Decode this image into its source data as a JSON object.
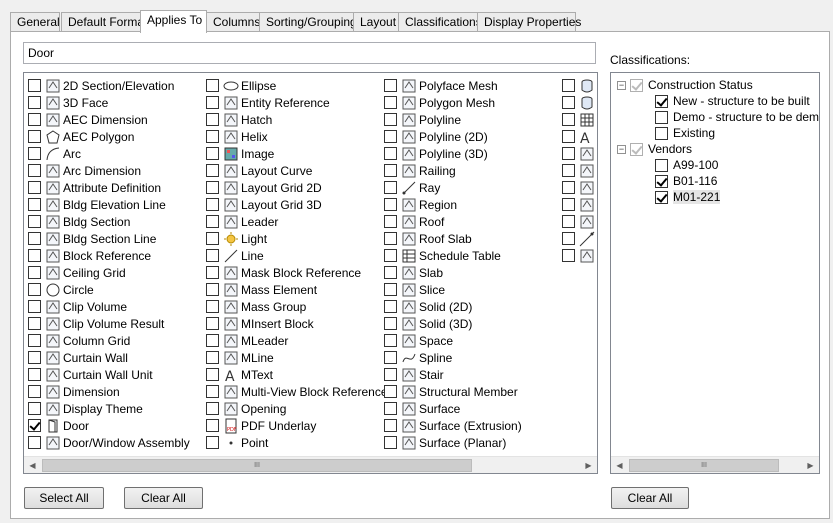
{
  "tabs": [
    "General",
    "Default Format",
    "Applies To",
    "Columns",
    "Sorting/Grouping",
    "Layout",
    "Classifications",
    "Display Properties"
  ],
  "active_tab": "Applies To",
  "filter_value": "Door",
  "columns": [
    [
      {
        "label": "2D Section/Elevation",
        "icon": "section-elevation-icon",
        "checked": false
      },
      {
        "label": "3D Face",
        "icon": "3d-face-icon",
        "checked": false
      },
      {
        "label": "AEC Dimension",
        "icon": "aec-dimension-icon",
        "checked": false
      },
      {
        "label": "AEC Polygon",
        "icon": "polygon-icon",
        "checked": false
      },
      {
        "label": "Arc",
        "icon": "arc-icon",
        "checked": false
      },
      {
        "label": "Arc Dimension",
        "icon": "arc-dimension-icon",
        "checked": false
      },
      {
        "label": "Attribute Definition",
        "icon": "attribute-icon",
        "checked": false
      },
      {
        "label": "Bldg Elevation Line",
        "icon": "elevation-line-icon",
        "checked": false
      },
      {
        "label": "Bldg Section",
        "icon": "bldg-section-icon",
        "checked": false
      },
      {
        "label": "Bldg Section Line",
        "icon": "section-line-icon",
        "checked": false
      },
      {
        "label": "Block Reference",
        "icon": "block-icon",
        "checked": false
      },
      {
        "label": "Ceiling Grid",
        "icon": "grid-icon",
        "checked": false
      },
      {
        "label": "Circle",
        "icon": "circle-icon",
        "checked": false
      },
      {
        "label": "Clip Volume",
        "icon": "clip-volume-icon",
        "checked": false
      },
      {
        "label": "Clip Volume Result",
        "icon": "clip-volume-result-icon",
        "checked": false
      },
      {
        "label": "Column Grid",
        "icon": "column-grid-icon",
        "checked": false
      },
      {
        "label": "Curtain Wall",
        "icon": "curtain-wall-icon",
        "checked": false
      },
      {
        "label": "Curtain Wall Unit",
        "icon": "curtain-wall-unit-icon",
        "checked": false
      },
      {
        "label": "Dimension",
        "icon": "dimension-icon",
        "checked": false
      },
      {
        "label": "Display Theme",
        "icon": "display-theme-icon",
        "checked": false
      },
      {
        "label": "Door",
        "icon": "door-icon",
        "checked": true
      },
      {
        "label": "Door/Window Assembly",
        "icon": "door-window-icon",
        "checked": false
      }
    ],
    [
      {
        "label": "Ellipse",
        "icon": "ellipse-icon",
        "checked": false
      },
      {
        "label": "Entity Reference",
        "icon": "entity-reference-icon",
        "checked": false
      },
      {
        "label": "Hatch",
        "icon": "hatch-icon",
        "checked": false
      },
      {
        "label": "Helix",
        "icon": "helix-icon",
        "checked": false
      },
      {
        "label": "Image",
        "icon": "image-icon",
        "checked": false
      },
      {
        "label": "Layout Curve",
        "icon": "layout-curve-icon",
        "checked": false
      },
      {
        "label": "Layout Grid 2D",
        "icon": "layout-grid-2d-icon",
        "checked": false
      },
      {
        "label": "Layout Grid 3D",
        "icon": "layout-grid-3d-icon",
        "checked": false
      },
      {
        "label": "Leader",
        "icon": "leader-icon",
        "checked": false
      },
      {
        "label": "Light",
        "icon": "light-icon",
        "checked": false
      },
      {
        "label": "Line",
        "icon": "line-icon",
        "checked": false
      },
      {
        "label": "Mask Block Reference",
        "icon": "mask-block-icon",
        "checked": false
      },
      {
        "label": "Mass Element",
        "icon": "mass-element-icon",
        "checked": false
      },
      {
        "label": "Mass Group",
        "icon": "mass-group-icon",
        "checked": false
      },
      {
        "label": "MInsert Block",
        "icon": "minsert-icon",
        "checked": false
      },
      {
        "label": "MLeader",
        "icon": "mleader-icon",
        "checked": false
      },
      {
        "label": "MLine",
        "icon": "mline-icon",
        "checked": false
      },
      {
        "label": "MText",
        "icon": "mtext-icon",
        "checked": false
      },
      {
        "label": "Multi-View Block Reference",
        "icon": "multiview-block-icon",
        "checked": false
      },
      {
        "label": "Opening",
        "icon": "opening-icon",
        "checked": false
      },
      {
        "label": "PDF Underlay",
        "icon": "pdf-icon",
        "checked": false
      },
      {
        "label": "Point",
        "icon": "point-icon",
        "checked": false
      }
    ],
    [
      {
        "label": "Polyface Mesh",
        "icon": "polyface-mesh-icon",
        "checked": false
      },
      {
        "label": "Polygon Mesh",
        "icon": "polygon-mesh-icon",
        "checked": false
      },
      {
        "label": "Polyline",
        "icon": "polyline-icon",
        "checked": false
      },
      {
        "label": "Polyline (2D)",
        "icon": "polyline-2d-icon",
        "checked": false
      },
      {
        "label": "Polyline (3D)",
        "icon": "polyline-3d-icon",
        "checked": false
      },
      {
        "label": "Railing",
        "icon": "railing-icon",
        "checked": false
      },
      {
        "label": "Ray",
        "icon": "ray-icon",
        "checked": false
      },
      {
        "label": "Region",
        "icon": "region-icon",
        "checked": false
      },
      {
        "label": "Roof",
        "icon": "roof-icon",
        "checked": false
      },
      {
        "label": "Roof Slab",
        "icon": "roof-slab-icon",
        "checked": false
      },
      {
        "label": "Schedule Table",
        "icon": "schedule-table-icon",
        "checked": false
      },
      {
        "label": "Slab",
        "icon": "slab-icon",
        "checked": false
      },
      {
        "label": "Slice",
        "icon": "slice-icon",
        "checked": false
      },
      {
        "label": "Solid (2D)",
        "icon": "solid-2d-icon",
        "checked": false
      },
      {
        "label": "Solid (3D)",
        "icon": "solid-3d-icon",
        "checked": false
      },
      {
        "label": "Space",
        "icon": "space-icon",
        "checked": false
      },
      {
        "label": "Spline",
        "icon": "spline-icon",
        "checked": false
      },
      {
        "label": "Stair",
        "icon": "stair-icon",
        "checked": false
      },
      {
        "label": "Structural Member",
        "icon": "structural-member-icon",
        "checked": false
      },
      {
        "label": "Surface",
        "icon": "surface-icon",
        "checked": false
      },
      {
        "label": "Surface (Extrusion)",
        "icon": "surface-extrusion-icon",
        "checked": false
      },
      {
        "label": "Surface (Planar)",
        "icon": "surface-planar-icon",
        "checked": false
      }
    ],
    [
      {
        "label": "",
        "icon": "cylinder-icon",
        "checked": false
      },
      {
        "label": "",
        "icon": "cylinder-icon",
        "checked": false
      },
      {
        "label": "",
        "icon": "table-icon",
        "checked": false
      },
      {
        "label": "",
        "icon": "text-icon",
        "checked": false
      },
      {
        "label": "",
        "icon": "tolerance-icon",
        "checked": false
      },
      {
        "label": "",
        "icon": "trace-icon",
        "checked": false
      },
      {
        "label": "",
        "icon": "view-icon",
        "checked": false
      },
      {
        "label": "",
        "icon": "wall-icon",
        "checked": false
      },
      {
        "label": "",
        "icon": "window-icon",
        "checked": false
      },
      {
        "label": "",
        "icon": "xline-icon",
        "checked": false
      },
      {
        "label": "",
        "icon": "zone-icon",
        "checked": false
      }
    ]
  ],
  "buttons": {
    "select_all": "Select All",
    "clear_all": "Clear All",
    "clear_all_classifications": "Clear All"
  },
  "classifications": {
    "label": "Classifications:",
    "groups": [
      {
        "label": "Construction Status",
        "items": [
          {
            "label": "New - structure to be built",
            "checked": true
          },
          {
            "label": "Demo - structure to be demolis",
            "checked": false
          },
          {
            "label": "Existing",
            "checked": false
          }
        ]
      },
      {
        "label": "Vendors",
        "items": [
          {
            "label": "A99-100",
            "checked": false
          },
          {
            "label": "B01-116",
            "checked": true
          },
          {
            "label": "M01-221",
            "checked": true,
            "selected": true
          }
        ]
      }
    ]
  },
  "scroll_grip": "III",
  "scroll_left": "◀",
  "scroll_right": "▶"
}
